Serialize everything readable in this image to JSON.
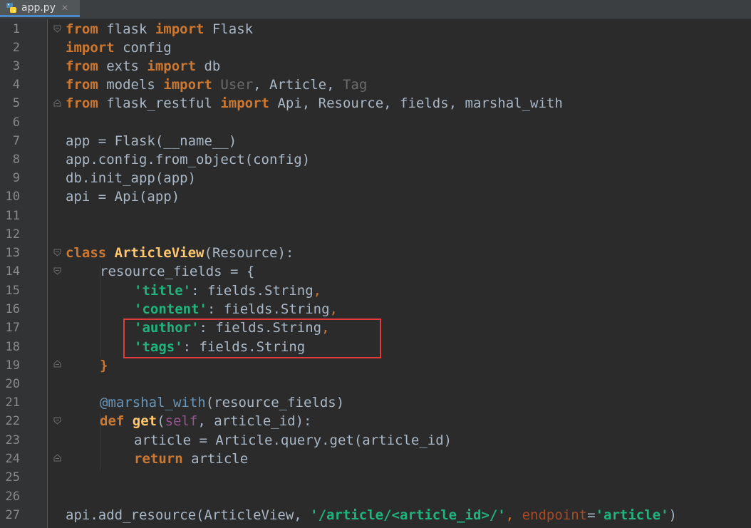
{
  "tab": {
    "filename": "app.py",
    "close_glyph": "✕",
    "icon": "python-file-icon"
  },
  "colors": {
    "keyword": "#cc7832",
    "string": "#1fb37d",
    "highlight_box": "#e33b3b",
    "background": "#2b2b2b"
  },
  "line_numbers": [
    "1",
    "2",
    "3",
    "4",
    "5",
    "6",
    "7",
    "8",
    "9",
    "10",
    "11",
    "12",
    "13",
    "14",
    "15",
    "16",
    "17",
    "18",
    "19",
    "20",
    "21",
    "22",
    "23",
    "24",
    "25",
    "26",
    "27"
  ],
  "code": {
    "l1": [
      "from",
      " flask ",
      "import",
      " Flask"
    ],
    "l2": [
      "import",
      " config"
    ],
    "l3": [
      "from",
      " exts ",
      "import",
      " db"
    ],
    "l4": [
      "from",
      " models ",
      "import",
      " ",
      "User",
      ", Article, ",
      "Tag"
    ],
    "l5": [
      "from",
      " flask_restful ",
      "import",
      " Api, Resource, fields, marshal_with"
    ],
    "l7": [
      "app = Flask(__name__)"
    ],
    "l8": [
      "app.config.from_object(config)"
    ],
    "l9": [
      "db.init_app(app)"
    ],
    "l10": [
      "api = Api(app)"
    ],
    "l13": [
      "class",
      " ",
      "ArticleView",
      "(Resource):"
    ],
    "l14": [
      "resource_fields = {"
    ],
    "l15": [
      "'title'",
      ": fields.String",
      ","
    ],
    "l16": [
      "'content'",
      ": fields.String",
      ","
    ],
    "l17": [
      "'author'",
      ": fields.String",
      ","
    ],
    "l18": [
      "'tags'",
      ": fields.String"
    ],
    "l19": [
      "}"
    ],
    "l21": [
      "@marshal_with",
      "(resource_fields)"
    ],
    "l22": [
      "def",
      " ",
      "get",
      "(",
      "self",
      ", article_id):"
    ],
    "l23": [
      "article = Article.query.get(article_id)"
    ],
    "l24": [
      "return",
      " article"
    ],
    "l27": [
      "api.add_resource(ArticleView, ",
      "'/article/<article_id>/'",
      ", ",
      "endpoint",
      "=",
      "'article'",
      ")"
    ]
  }
}
